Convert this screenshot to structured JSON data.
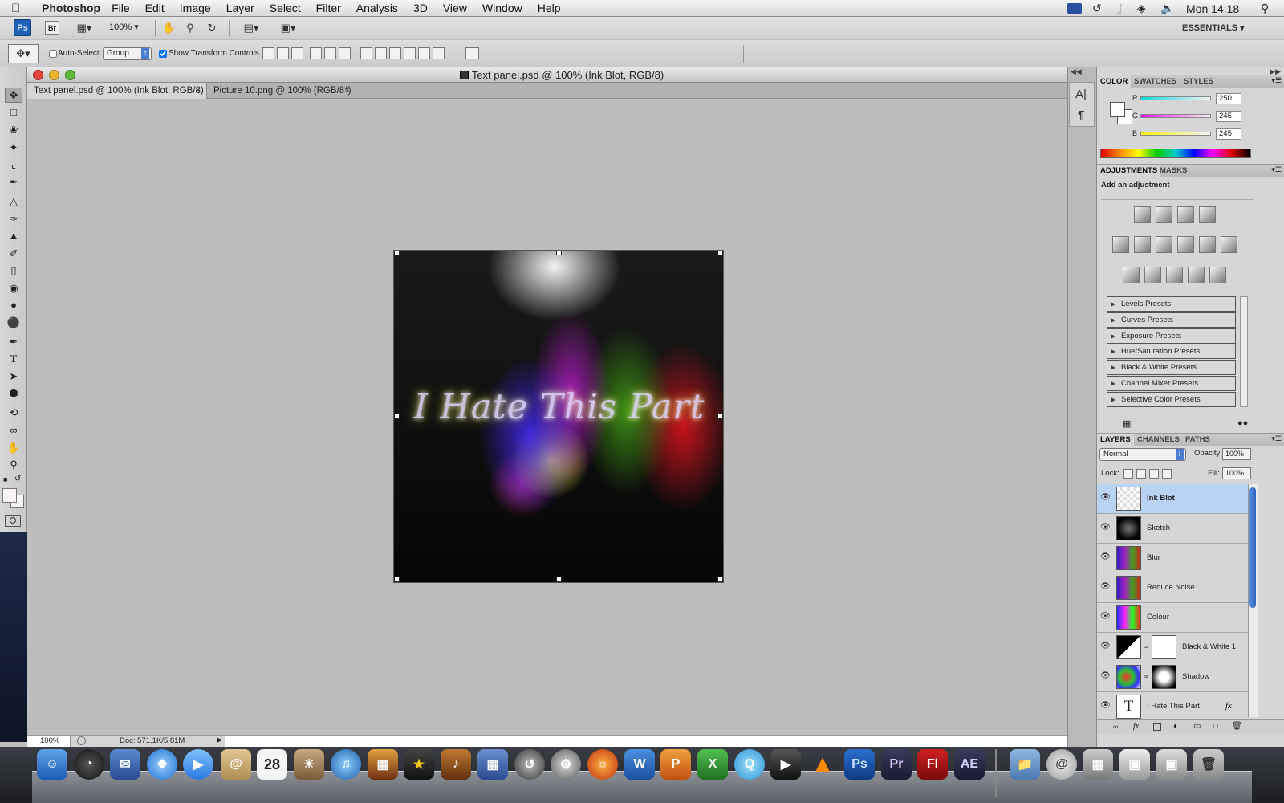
{
  "menubar": {
    "app_name": "Photoshop",
    "menus": [
      "File",
      "Edit",
      "Image",
      "Layer",
      "Select",
      "Filter",
      "Analysis",
      "3D",
      "View",
      "Window",
      "Help"
    ],
    "clock": "Mon 14:18",
    "status_icons": [
      "flag-icon",
      "time-machine-icon",
      "bluetooth-icon",
      "wifi-icon",
      "volume-icon",
      "spotlight-icon"
    ]
  },
  "appbar": {
    "ps_label": "Ps",
    "br_label": "Br",
    "zoom": "100%",
    "workspace": "ESSENTIALS"
  },
  "options": {
    "auto_select_label": "Auto-Select:",
    "auto_select_value": "Group",
    "show_transform_label": "Show Transform Controls",
    "show_transform_checked": true
  },
  "document": {
    "window_title": "Text panel.psd @ 100% (Ink Blot, RGB/8)",
    "tabs": [
      {
        "label": "Text panel.psd @ 100% (Ink Blot, RGB/8)",
        "active": true
      },
      {
        "label": "Picture 10.png @ 100% (RGB/8*)",
        "active": false
      }
    ],
    "close_glyph": "×",
    "artwork_text": "I Hate This Part",
    "status_zoom": "100%",
    "status_doc": "Doc: 571.1K/5.81M"
  },
  "color_panel": {
    "tabs": [
      "COLOR",
      "SWATCHES",
      "STYLES"
    ],
    "channels": [
      {
        "label": "R",
        "value": "250"
      },
      {
        "label": "G",
        "value": "245"
      },
      {
        "label": "B",
        "value": "245"
      }
    ]
  },
  "adjustments_panel": {
    "tabs": [
      "ADJUSTMENTS",
      "MASKS"
    ],
    "heading": "Add an adjustment",
    "presets": [
      "Levels Presets",
      "Curves Presets",
      "Exposure Presets",
      "Hue/Saturation Presets",
      "Black & White Presets",
      "Channel Mixer Presets",
      "Selective Color Presets"
    ]
  },
  "layers_panel": {
    "tabs": [
      "LAYERS",
      "CHANNELS",
      "PATHS"
    ],
    "blend_mode": "Normal",
    "opacity_label": "Opacity:",
    "opacity_value": "100%",
    "lock_label": "Lock:",
    "fill_label": "Fill:",
    "fill_value": "100%",
    "layers": [
      {
        "name": "Ink Blot",
        "selected": true
      },
      {
        "name": "Sketch",
        "selected": false
      },
      {
        "name": "Blur",
        "selected": false
      },
      {
        "name": "Reduce Noise",
        "selected": false
      },
      {
        "name": "Colour",
        "selected": false
      },
      {
        "name": "Black & White 1",
        "selected": false
      },
      {
        "name": "Shadow",
        "selected": false
      },
      {
        "name": "I Hate This Part",
        "selected": false
      }
    ],
    "text_layer_glyph": "T",
    "fx_label": "fx"
  },
  "dock": {
    "labels": [
      "Ps",
      "Pr",
      "Fl",
      "AE"
    ],
    "calendar_day": "28"
  },
  "colors": {
    "ps_blue": "#1f62b3",
    "selection_blue": "#b9d3f3",
    "close_red": "#e0443c",
    "minimize_yellow": "#e9b32c",
    "zoom_green": "#5fb83d"
  }
}
